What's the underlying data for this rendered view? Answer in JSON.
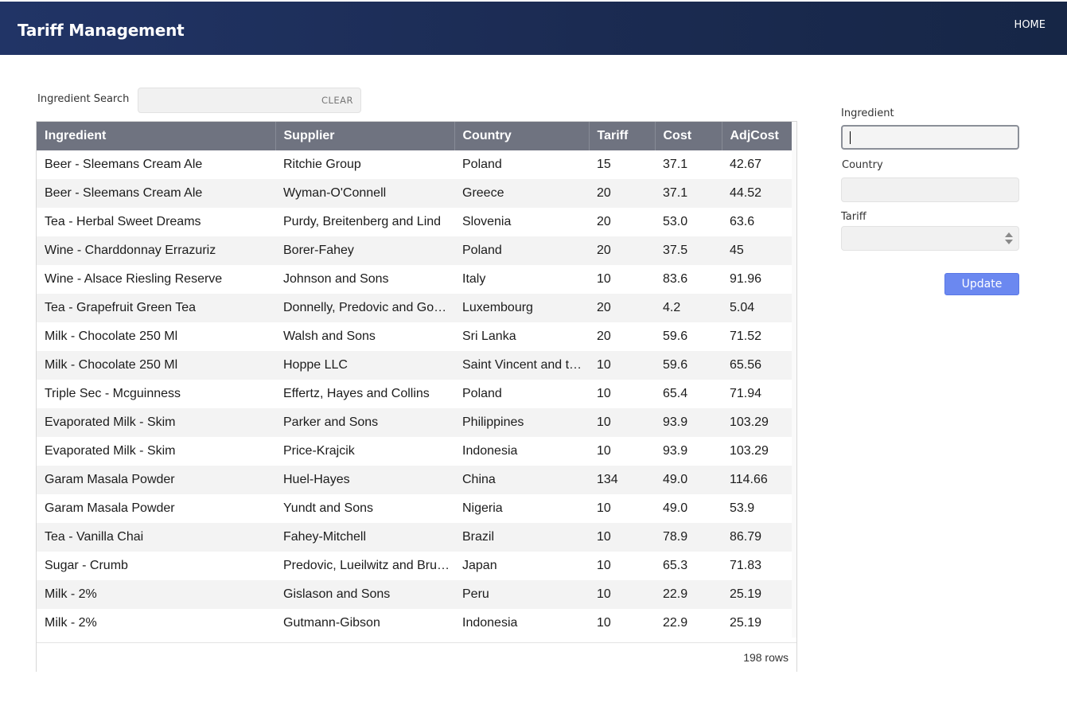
{
  "header": {
    "title": "Tariff Management",
    "home_label": "HOME",
    "colors": {
      "bar_start": "#213466",
      "bar_end": "#162646"
    }
  },
  "search": {
    "label": "Ingredient Search",
    "value": "",
    "clear_label": "CLEAR"
  },
  "grid": {
    "columns": [
      "Ingredient",
      "Supplier",
      "Country",
      "Tariff",
      "Cost",
      "AdjCost"
    ],
    "rows": [
      [
        "Beer - Sleemans Cream Ale",
        "Ritchie Group",
        "Poland",
        "15",
        "37.1",
        "42.67"
      ],
      [
        "Beer - Sleemans Cream Ale",
        "Wyman-O'Connell",
        "Greece",
        "20",
        "37.1",
        "44.52"
      ],
      [
        "Tea - Herbal Sweet Dreams",
        "Purdy, Breitenberg and Lind",
        "Slovenia",
        "20",
        "53.0",
        "63.6"
      ],
      [
        "Wine - Charddonnay Errazuriz",
        "Borer-Fahey",
        "Poland",
        "20",
        "37.5",
        "45"
      ],
      [
        "Wine - Alsace Riesling Reserve",
        "Johnson and Sons",
        "Italy",
        "10",
        "83.6",
        "91.96"
      ],
      [
        "Tea - Grapefruit Green Tea",
        "Donnelly, Predovic and Go…",
        "Luxembourg",
        "20",
        "4.2",
        "5.04"
      ],
      [
        "Milk - Chocolate 250 Ml",
        "Walsh and Sons",
        "Sri Lanka",
        "20",
        "59.6",
        "71.52"
      ],
      [
        "Milk - Chocolate 250 Ml",
        "Hoppe LLC",
        "Saint Vincent and t…",
        "10",
        "59.6",
        "65.56"
      ],
      [
        "Triple Sec - Mcguinness",
        "Effertz, Hayes and Collins",
        "Poland",
        "10",
        "65.4",
        "71.94"
      ],
      [
        "Evaporated Milk - Skim",
        "Parker and Sons",
        "Philippines",
        "10",
        "93.9",
        "103.29"
      ],
      [
        "Evaporated Milk - Skim",
        "Price-Krajcik",
        "Indonesia",
        "10",
        "93.9",
        "103.29"
      ],
      [
        "Garam Masala Powder",
        "Huel-Hayes",
        "China",
        "134",
        "49.0",
        "114.66"
      ],
      [
        "Garam Masala Powder",
        "Yundt and Sons",
        "Nigeria",
        "10",
        "49.0",
        "53.9"
      ],
      [
        "Tea - Vanilla Chai",
        "Fahey-Mitchell",
        "Brazil",
        "10",
        "78.9",
        "86.79"
      ],
      [
        "Sugar - Crumb",
        "Predovic, Lueilwitz and Bru…",
        "Japan",
        "10",
        "65.3",
        "71.83"
      ],
      [
        "Milk - 2%",
        "Gislason and Sons",
        "Peru",
        "10",
        "22.9",
        "25.19"
      ],
      [
        "Milk - 2%",
        "Gutmann-Gibson",
        "Indonesia",
        "10",
        "22.9",
        "25.19"
      ]
    ],
    "row_count_label": "198 rows"
  },
  "form": {
    "ingredient_label": "Ingredient",
    "ingredient_value": "",
    "country_label": "Country",
    "country_value": "",
    "tariff_label": "Tariff",
    "tariff_value": "",
    "update_label": "Update",
    "accent_color": "#6b88f0"
  }
}
